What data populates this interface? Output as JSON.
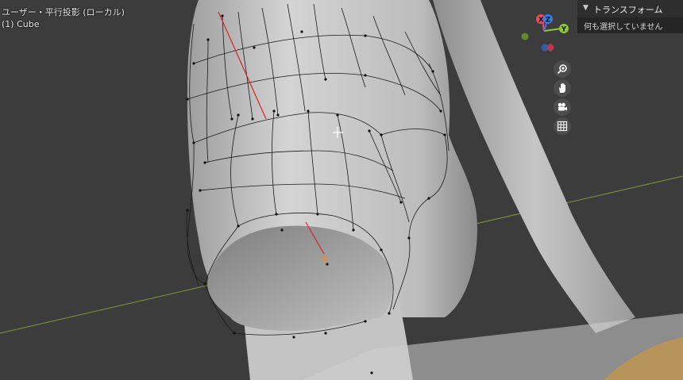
{
  "viewport": {
    "title": "ユーザー・平行投影 (ローカル)",
    "object": "(1) Cube"
  },
  "sidebar": {
    "panel_title": "トランスフォーム",
    "empty_message": "何も選択していません"
  },
  "gizmo": {
    "x_label": "X",
    "z_label": "Z",
    "y_label": "Y"
  },
  "navigation": [
    "zoom-icon",
    "hand-icon",
    "camera-icon",
    "grid-icon"
  ],
  "colors": {
    "background": "#3c3c3c",
    "mesh": "#c8c8c8",
    "x_axis_line": "#7a9a3a",
    "x_axis": "#e84a5f",
    "y_axis": "#8cc83a",
    "z_axis": "#3a7be8",
    "seam": "#e02020",
    "selected_vertex": "#f08c1e"
  }
}
